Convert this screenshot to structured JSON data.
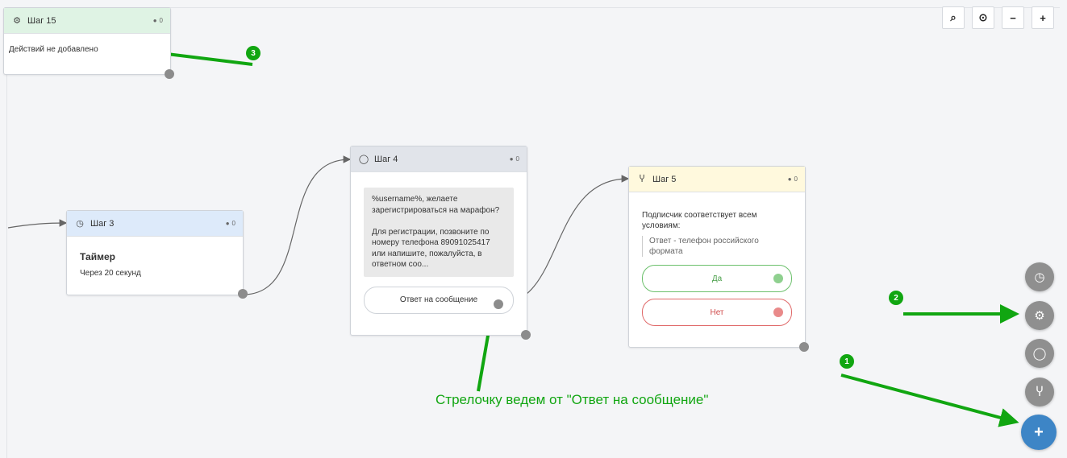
{
  "nodes": {
    "step15": {
      "title": "Шаг 15",
      "count": "0",
      "body": "Действий не добавлено"
    },
    "step3": {
      "title": "Шаг 3",
      "count": "0",
      "heading": "Таймер",
      "detail": "Через 20 секунд"
    },
    "step4": {
      "title": "Шаг 4",
      "count": "0",
      "message": "%username%, желаете зарегистрироваться на марафон?\n\nДля регистрации, позвоните по номеру телефона 89091025417 или напишите, пожалуйста, в ответном соо...",
      "reply_button": "Ответ на сообщение"
    },
    "step5": {
      "title": "Шаг 5",
      "count": "0",
      "condition_text": "Подписчик соответствует всем условиям:",
      "condition_item": "Ответ - телефон российского формата",
      "yes_label": "Да",
      "no_label": "Нет"
    }
  },
  "toolbar": {
    "search_icon": "search-icon",
    "target_icon": "target-icon",
    "zoom_out": "−",
    "zoom_in": "+"
  },
  "fab": {
    "timer_icon": "clock-icon",
    "action_icon": "gears-icon",
    "message_icon": "speech-bubble-icon",
    "condition_icon": "fork-icon",
    "add_icon": "plus-icon"
  },
  "annotations": {
    "badge1": "1",
    "badge2": "2",
    "badge3": "3",
    "caption": "Стрелочку ведем от \"Ответ на сообщение\""
  },
  "colors": {
    "step15_header": "#dff3e4",
    "step3_header": "#ddeafa",
    "step4_header": "#e1e4ea",
    "step5_header": "#fff9dd",
    "yes": "#6cc06c",
    "no": "#e06a6a",
    "annotation": "#11a611",
    "fab_main": "#3d85c6"
  }
}
